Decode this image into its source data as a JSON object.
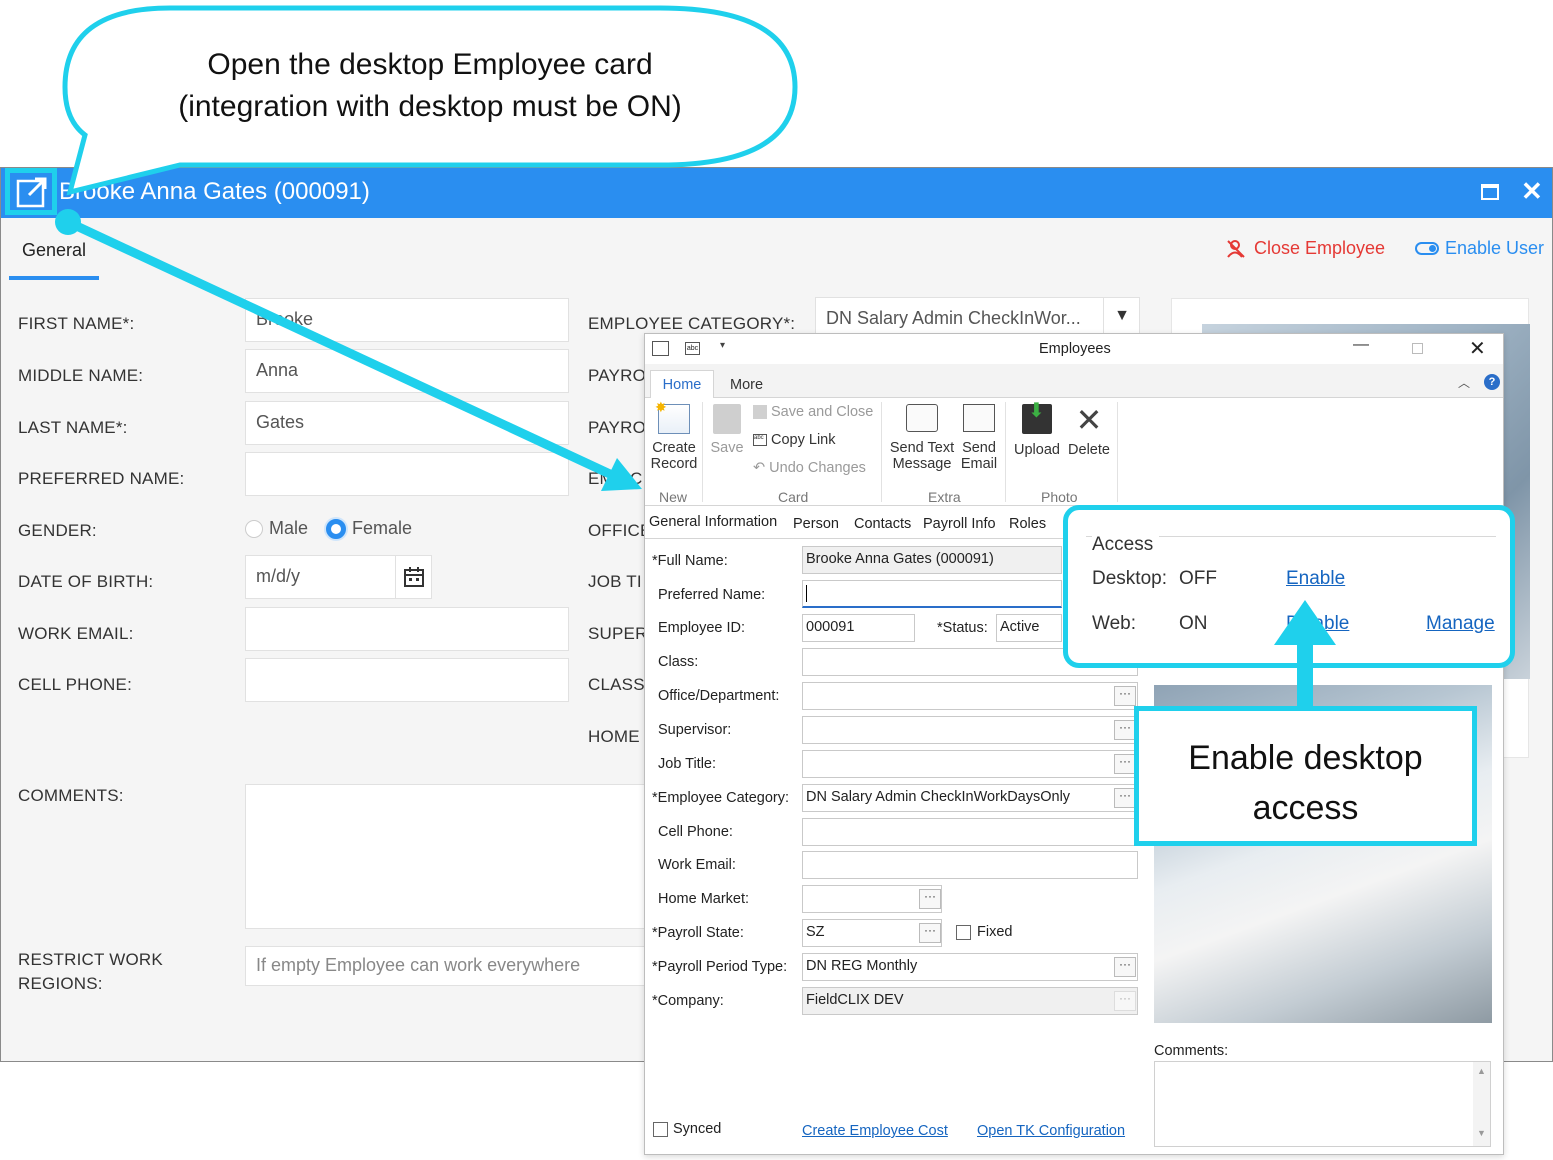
{
  "callout_top": {
    "line1": "Open the desktop Employee card",
    "line2": "(integration with desktop must be ON)"
  },
  "callout_right": {
    "line1": "Enable desktop",
    "line2": "access"
  },
  "web": {
    "title": "Brooke Anna Gates (000091)",
    "tab_general": "General",
    "close_employee": "Close Employee",
    "enable_user": "Enable User",
    "labels": {
      "first_name": "FIRST NAME*:",
      "middle_name": "MIDDLE NAME:",
      "last_name": "LAST NAME*:",
      "preferred_name": "PREFERRED NAME:",
      "gender": "GENDER:",
      "dob": "DATE OF BIRTH:",
      "work_email": "WORK EMAIL:",
      "cell_phone": "CELL PHONE:",
      "comments": "COMMENTS:",
      "restrict_line1": "RESTRICT WORK",
      "restrict_line2": "REGIONS:",
      "employee_category": "EMPLOYEE CATEGORY*:",
      "payroll1": "PAYRO",
      "payroll2": "PAYRO",
      "emp_c": "EMP C",
      "office": "OFFICE",
      "job_title": "JOB TI",
      "supervisor": "SUPER",
      "class": "CLASS:",
      "home": "HOME"
    },
    "values": {
      "first_name": "Brooke",
      "middle_name": "Anna",
      "last_name": "Gates",
      "dob_placeholder": "m/d/y",
      "gender_male": "Male",
      "gender_female": "Female",
      "gender_selected": "Female",
      "restrict_placeholder": "If empty Employee can work everywhere",
      "employee_category": "DN Salary Admin CheckInWor..."
    }
  },
  "desktop": {
    "title": "Employees",
    "ribbon_tabs": [
      "Home",
      "More"
    ],
    "create_record": [
      "Create",
      "Record"
    ],
    "save": "Save",
    "save_and_close": "Save and Close",
    "copy_link": "Copy Link",
    "undo_changes": "Undo Changes",
    "send_text": [
      "Send Text",
      "Message"
    ],
    "send_email": [
      "Send",
      "Email"
    ],
    "upload": "Upload",
    "delete": "Delete",
    "groups": {
      "new": "New",
      "card": "Card",
      "extra": "Extra",
      "photo": "Photo"
    },
    "form_tabs": [
      "General Information",
      "Person",
      "Contacts",
      "Payroll Info",
      "Roles"
    ],
    "fields": {
      "full_name_label": "*Full Name:",
      "full_name": "Brooke Anna Gates (000091)",
      "preferred_name_label": "Preferred Name:",
      "employee_id_label": "Employee ID:",
      "employee_id": "000091",
      "status_label": "*Status:",
      "status": "Active",
      "class_label": "Class:",
      "office_label": "Office/Department:",
      "supervisor_label": "Supervisor:",
      "job_title_label": "Job Title:",
      "employee_category_label": "*Employee Category:",
      "employee_category": "DN Salary Admin CheckInWorkDaysOnly",
      "cell_phone_label": "Cell Phone:",
      "work_email_label": "Work Email:",
      "home_market_label": "Home Market:",
      "payroll_state_label": "*Payroll State:",
      "payroll_state": "SZ",
      "fixed_label": "Fixed",
      "payroll_period_label": "*Payroll Period Type:",
      "payroll_period": "DN REG Monthly",
      "company_label": "*Company:",
      "company": "FieldCLIX DEV"
    },
    "access": {
      "title": "Access",
      "desktop_label": "Desktop:",
      "desktop_value": "OFF",
      "desktop_action": "Enable",
      "web_label": "Web:",
      "web_value": "ON",
      "web_action": "Disable",
      "manage": "Manage"
    },
    "comments_label": "Comments:",
    "synced_label": "Synced",
    "create_employee_cost": "Create Employee Cost",
    "open_tk_configuration": "Open TK Configuration"
  },
  "colors": {
    "accent": "#2a8ef0",
    "callout": "#1fd0ec",
    "danger": "#e53935",
    "link": "#1565c0"
  }
}
